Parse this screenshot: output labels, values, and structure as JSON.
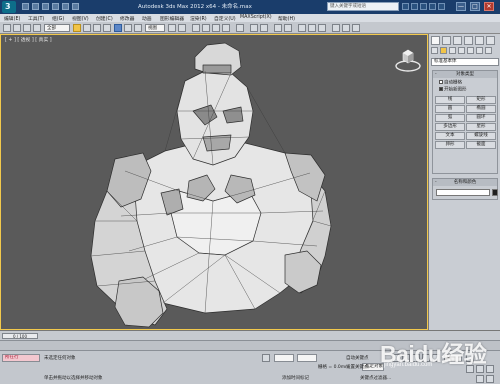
{
  "titlebar": {
    "title": "Autodesk 3ds Max 2012 x64   - 未命名.max",
    "search_placeholder": "键入关键字或短语",
    "minimize": "—",
    "maximize": "□",
    "close": "✕"
  },
  "menubar": {
    "items": [
      "编辑(E)",
      "工具(T)",
      "组(G)",
      "视图(V)",
      "创建(C)",
      "修改器",
      "动画",
      "图形编辑器",
      "渲染(R)",
      "自定义(U)",
      "MAXScript(X)",
      "帮助(H)"
    ]
  },
  "toolbar": {
    "selection_filter": "全部",
    "view_dropdown": "视图"
  },
  "viewport": {
    "label": "[ + ] [ 透视 ] [ 真实 ]"
  },
  "command_panel": {
    "object_type_dropdown": "标准基本体",
    "rollout_object_type": "对象类型",
    "autogrid_label": "自动栅格",
    "start_new_shape_label": "开始新图形",
    "buttons": [
      "线",
      "矩形",
      "圆",
      "椭圆",
      "弧",
      "圆环",
      "多边形",
      "星形",
      "文本",
      "螺旋线",
      "卵形",
      "截面"
    ],
    "rollout_name_color": "名称和颜色",
    "name_value": ""
  },
  "timeslider": {
    "label": "0 / 100"
  },
  "status": {
    "maxscript_label": "所在行",
    "prompt_selected": "未选定任何对象",
    "prompt_hint": "单击并拖动以选择并移动对象",
    "add_time_tag": "添加时间标记",
    "grid_label": "栅格 = 0.0mm",
    "auto_key": "自动关键点",
    "selected_object": "选定对象",
    "set_key": "设置关键点",
    "key_filters": "关键点过滤器...",
    "frame": "0"
  },
  "watermark": {
    "brand": "Baidu经验",
    "url": "jingyan.baidu.com"
  },
  "colors": {
    "titlebar": "#1a3d6b",
    "viewport_bg": "#5a5a5a",
    "viewport_border": "#f2c94c",
    "panel": "#c9cdd3",
    "active_tool": "#f1c447"
  }
}
